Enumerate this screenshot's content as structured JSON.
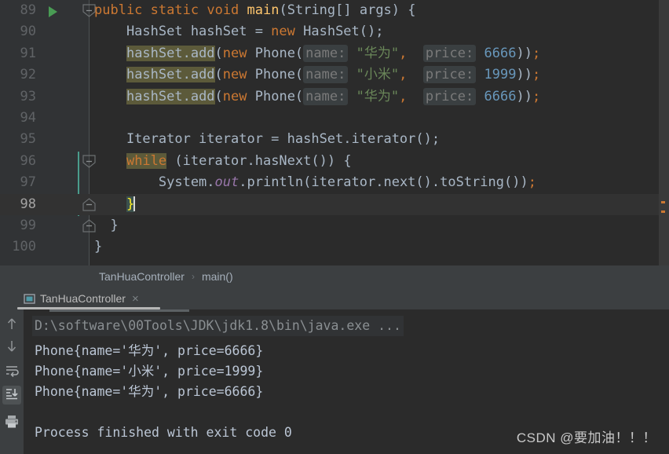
{
  "editor": {
    "lines": [
      {
        "number": "89",
        "indent": 0,
        "has_run_arrow": true,
        "fold": "down",
        "current": false,
        "tokens": [
          {
            "t": "public",
            "c": "kw"
          },
          {
            "t": " ",
            "c": "ident"
          },
          {
            "t": "static",
            "c": "kw"
          },
          {
            "t": " ",
            "c": "ident"
          },
          {
            "t": "void",
            "c": "kw"
          },
          {
            "t": " ",
            "c": "ident"
          },
          {
            "t": "main",
            "c": "method"
          },
          {
            "t": "(String[] args) {",
            "c": "ident"
          }
        ]
      },
      {
        "number": "90",
        "current": false,
        "tokens": [
          {
            "t": "    HashSet hashSet = ",
            "c": "ident"
          },
          {
            "t": "new",
            "c": "kw"
          },
          {
            "t": " HashSet();",
            "c": "ident"
          }
        ]
      },
      {
        "number": "91",
        "current": false,
        "tokens": [
          {
            "t": "    ",
            "c": "ident"
          },
          {
            "t": "hashSet.add",
            "c": "ident-hl"
          },
          {
            "t": "(",
            "c": "ident"
          },
          {
            "t": "new",
            "c": "kw"
          },
          {
            "t": " Phone(",
            "c": "ident"
          },
          {
            "t": "name:",
            "c": "hint"
          },
          {
            "t": " ",
            "c": "ident"
          },
          {
            "t": "\"华为\"",
            "c": "str"
          },
          {
            "t": ",",
            "c": "punct"
          },
          {
            "t": "  ",
            "c": "ident"
          },
          {
            "t": "price:",
            "c": "hint"
          },
          {
            "t": " ",
            "c": "ident"
          },
          {
            "t": "6666",
            "c": "num"
          },
          {
            "t": "))",
            "c": "ident"
          },
          {
            "t": ";",
            "c": "punct"
          }
        ]
      },
      {
        "number": "92",
        "current": false,
        "tokens": [
          {
            "t": "    ",
            "c": "ident"
          },
          {
            "t": "hashSet.add",
            "c": "ident-hl"
          },
          {
            "t": "(",
            "c": "ident"
          },
          {
            "t": "new",
            "c": "kw"
          },
          {
            "t": " Phone(",
            "c": "ident"
          },
          {
            "t": "name:",
            "c": "hint"
          },
          {
            "t": " ",
            "c": "ident"
          },
          {
            "t": "\"小米\"",
            "c": "str"
          },
          {
            "t": ",",
            "c": "punct"
          },
          {
            "t": "  ",
            "c": "ident"
          },
          {
            "t": "price:",
            "c": "hint"
          },
          {
            "t": " ",
            "c": "ident"
          },
          {
            "t": "1999",
            "c": "num"
          },
          {
            "t": "))",
            "c": "ident"
          },
          {
            "t": ";",
            "c": "punct"
          }
        ]
      },
      {
        "number": "93",
        "current": false,
        "tokens": [
          {
            "t": "    ",
            "c": "ident"
          },
          {
            "t": "hashSet.add",
            "c": "ident-hl"
          },
          {
            "t": "(",
            "c": "ident"
          },
          {
            "t": "new",
            "c": "kw"
          },
          {
            "t": " Phone(",
            "c": "ident"
          },
          {
            "t": "name:",
            "c": "hint"
          },
          {
            "t": " ",
            "c": "ident"
          },
          {
            "t": "\"华为\"",
            "c": "str"
          },
          {
            "t": ",",
            "c": "punct"
          },
          {
            "t": "  ",
            "c": "ident"
          },
          {
            "t": "price:",
            "c": "hint"
          },
          {
            "t": " ",
            "c": "ident"
          },
          {
            "t": "6666",
            "c": "num"
          },
          {
            "t": "))",
            "c": "ident"
          },
          {
            "t": ";",
            "c": "punct"
          }
        ]
      },
      {
        "number": "94",
        "current": false,
        "tokens": []
      },
      {
        "number": "95",
        "current": false,
        "tokens": [
          {
            "t": "    Iterator iterator = hashSet.iterator();",
            "c": "ident"
          }
        ]
      },
      {
        "number": "96",
        "fold": "down",
        "current": false,
        "tokens": [
          {
            "t": "    ",
            "c": "ident"
          },
          {
            "t": "while",
            "c": "kw-hl"
          },
          {
            "t": " (iterator.hasNext()) ",
            "c": "ident"
          },
          {
            "t": "{",
            "c": "brace"
          }
        ]
      },
      {
        "number": "97",
        "current": false,
        "tokens": [
          {
            "t": "        System.",
            "c": "ident"
          },
          {
            "t": "out",
            "c": "field"
          },
          {
            "t": ".println(iterator.next().toString())",
            "c": "ident"
          },
          {
            "t": ";",
            "c": "punct"
          }
        ]
      },
      {
        "number": "98",
        "fold": "up",
        "current": true,
        "caret": true,
        "tokens": [
          {
            "t": "    ",
            "c": "ident"
          },
          {
            "t": "}",
            "c": "brace-m"
          }
        ]
      },
      {
        "number": "99",
        "fold": "up",
        "current": false,
        "tokens": [
          {
            "t": "  }",
            "c": "ident"
          }
        ]
      },
      {
        "number": "100",
        "current": false,
        "tokens": [
          {
            "t": "}",
            "c": "ident"
          }
        ]
      }
    ]
  },
  "breadcrumb": {
    "class_name": "TanHuaController",
    "separator": "›",
    "method_name": "main()"
  },
  "console_tab": {
    "label": "TanHuaController",
    "close_label": "×",
    "icon": "console-icon"
  },
  "console_toolbar": {
    "buttons": [
      {
        "name": "scroll-up-button",
        "icon": "arrow-up-icon",
        "pressed": false
      },
      {
        "name": "scroll-down-button",
        "icon": "arrow-down-icon",
        "pressed": false
      },
      {
        "name": "soft-wrap-button",
        "icon": "soft-wrap-icon",
        "pressed": false
      },
      {
        "name": "scroll-to-end-button",
        "icon": "scroll-to-end-icon",
        "pressed": true
      },
      {
        "name": "print-button",
        "icon": "printer-icon",
        "pressed": false
      }
    ]
  },
  "console_output": {
    "command": "D:\\software\\00Tools\\JDK\\jdk1.8\\bin\\java.exe ...",
    "lines": [
      "Phone{name='华为', price=6666}",
      "Phone{name='小米', price=1999}",
      "Phone{name='华为', price=6666}",
      "",
      "Process finished with exit code 0"
    ]
  },
  "watermark": {
    "text": "CSDN @要加油！！！"
  },
  "colors": {
    "editor_bg": "#2b2b2b",
    "gutter_bg": "#313335",
    "panel_bg": "#3c3f41",
    "keyword": "#cc7832",
    "string": "#6a8759",
    "number": "#6897bb",
    "identifier": "#a9b7c6",
    "method": "#ffc66d",
    "field_italic": "#9876aa",
    "highlight_bg": "#5c5a3a",
    "run_green": "#499c54",
    "change_bar": "#4a9c8c",
    "brace_match": "#ffef28"
  }
}
